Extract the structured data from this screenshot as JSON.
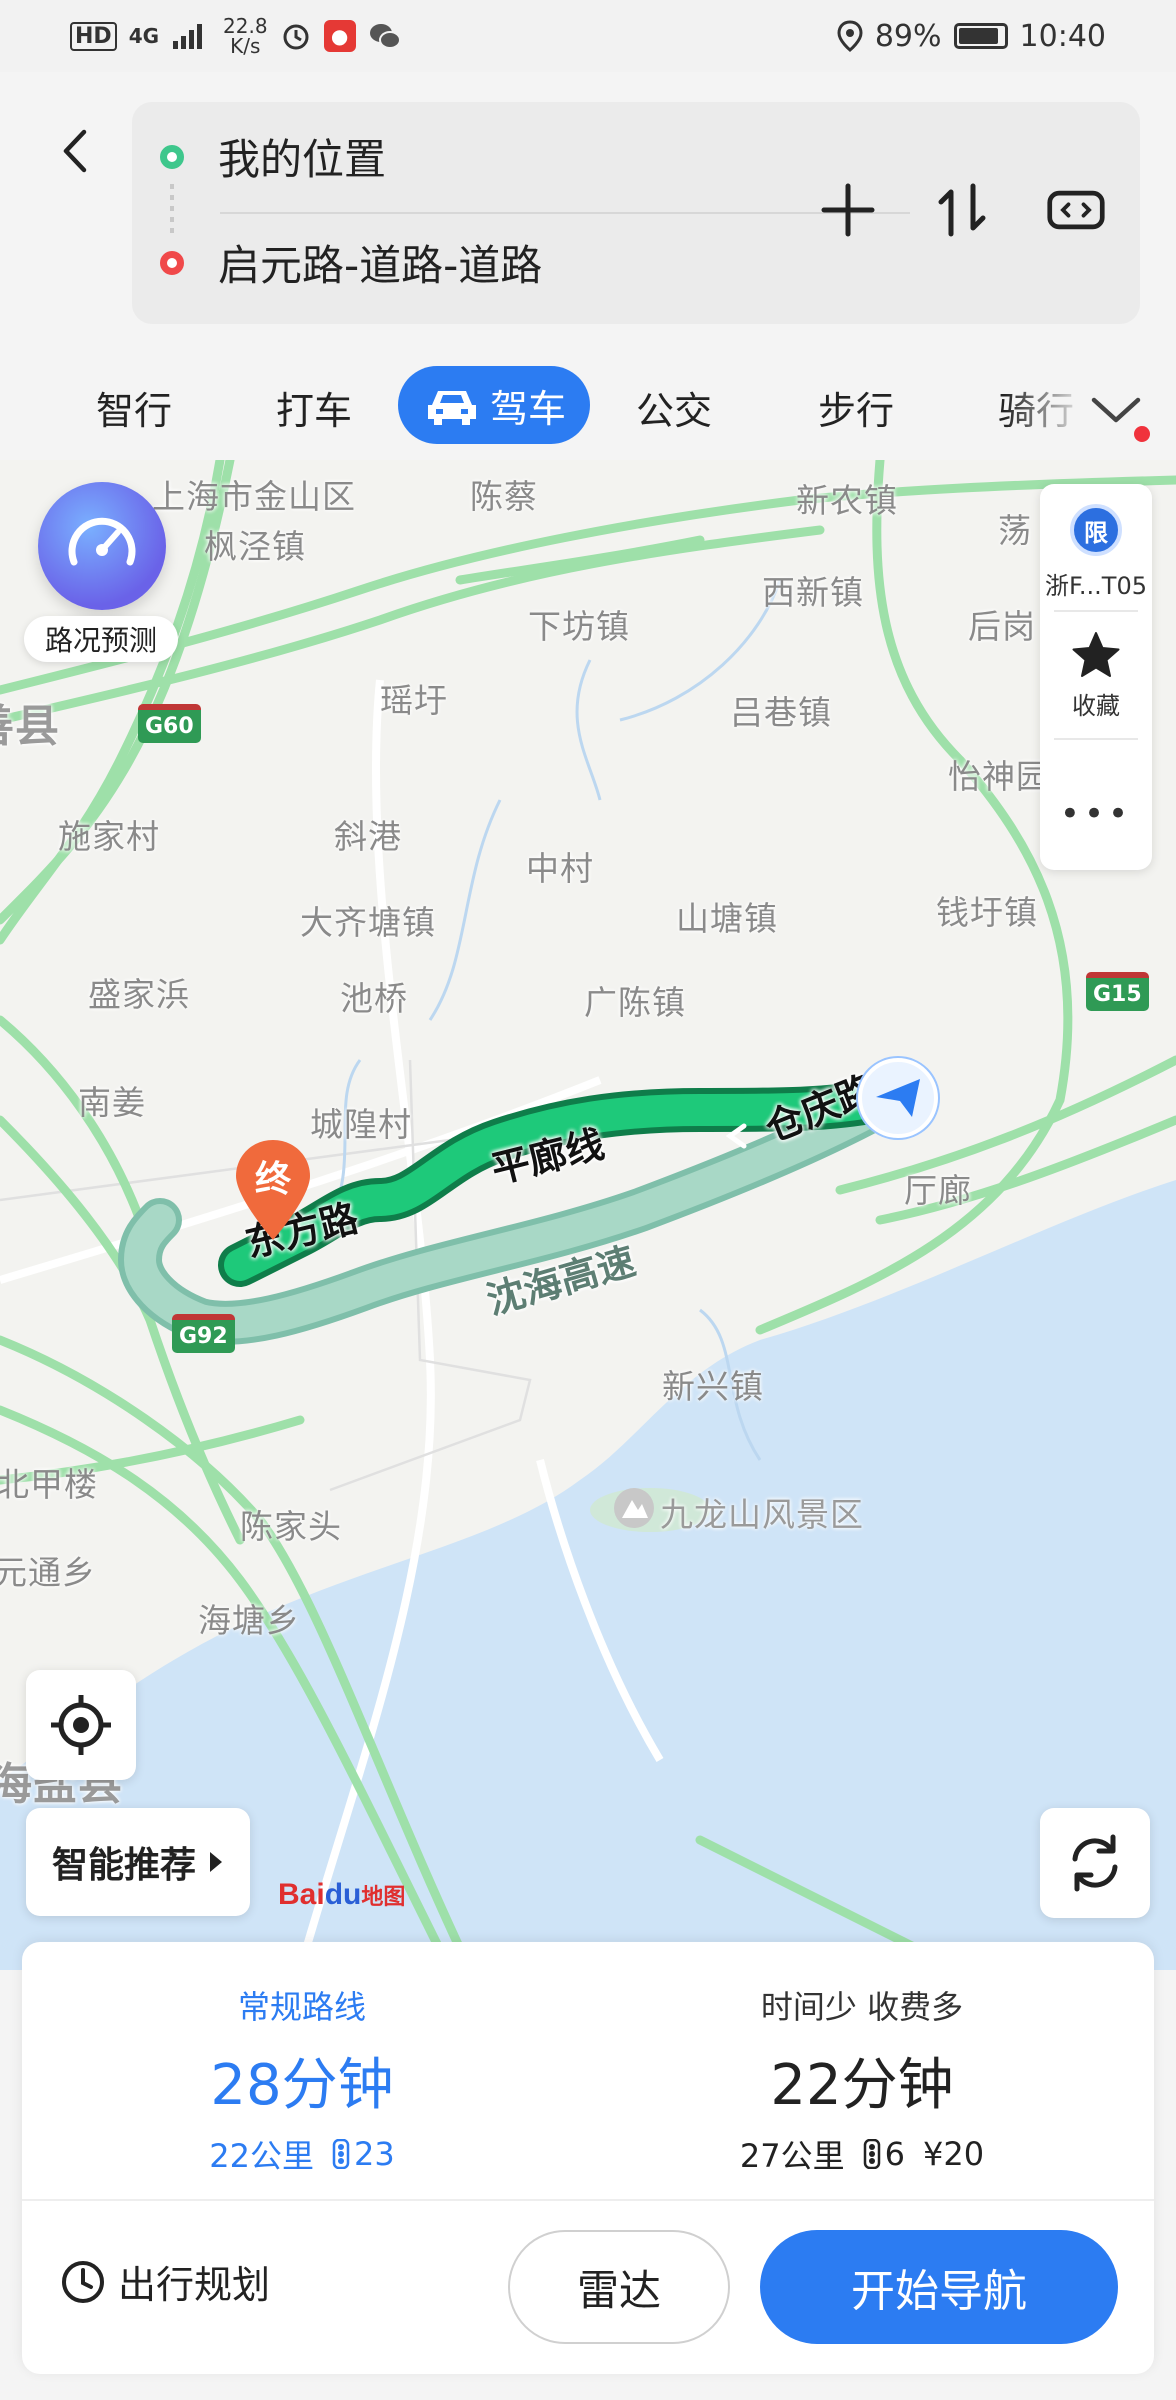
{
  "status_bar": {
    "hd": "HD",
    "network": "4G",
    "speed": "22.8",
    "speed_unit": "K/s",
    "battery": "89%",
    "battery_level": 0.89,
    "time": "10:40"
  },
  "route": {
    "start": "我的位置",
    "end": "启元路-道路-道路"
  },
  "modes": {
    "smart": "智行",
    "taxi": "打车",
    "drive": "驾车",
    "bus": "公交",
    "walk": "步行",
    "ride": "骑行"
  },
  "map": {
    "traffic_label": "路况预测",
    "limit_badge": "限",
    "limit_plate": "浙F...T05",
    "favorite": "收藏",
    "more": "•••",
    "recommend": "智能推荐",
    "end_marker": "终",
    "logo_text": "Bai",
    "logo_paw": "du",
    "logo_sub": "地图",
    "places": {
      "p1": "上海市金山区",
      "p2": "枫泾镇",
      "p3": "陈蔡",
      "p4": "新农镇",
      "p5": "荡",
      "p6": "西新镇",
      "p7": "下坊镇",
      "p8": "后岗",
      "p9": "善县",
      "p10": "瑶圩",
      "p11": "吕巷镇",
      "p12": "怡神园",
      "p13": "施家村",
      "p14": "斜港",
      "p15": "中村",
      "p16": "大齐塘镇",
      "p17": "山塘镇",
      "p18": "钱圩镇",
      "p19": "盛家浜",
      "p20": "池桥",
      "p21": "广陈镇",
      "p22": "南姜",
      "p23": "城隍村",
      "p24": "厅廊",
      "p25": "新兴镇",
      "p26": "北甲楼",
      "p27": "九龙山风景区",
      "p28": "陈家头",
      "p29": "元通乡",
      "p30": "海塘乡",
      "p31": "海盐县"
    },
    "shields": {
      "g60": "G60",
      "g15": "G15",
      "g92": "G92"
    },
    "roads": {
      "r1": "东方路",
      "r2": "平廊线",
      "r3": "仓庆路",
      "r4": "沈海高速"
    }
  },
  "routes": [
    {
      "tag": "常规路线",
      "time": "28分钟",
      "distance": "22公里",
      "lights": "23",
      "toll": ""
    },
    {
      "tag": "时间少 收费多",
      "time": "22分钟",
      "distance": "27公里",
      "lights": "6",
      "toll": "¥20"
    }
  ],
  "actions": {
    "plan": "出行规划",
    "radar": "雷达",
    "navigate": "开始导航"
  },
  "colors": {
    "accent": "#2c7cf2",
    "route_main": "#14b96a",
    "route_alt": "#9fd4c2",
    "water": "#cfe4f7",
    "highway": "#9ee0a9"
  }
}
